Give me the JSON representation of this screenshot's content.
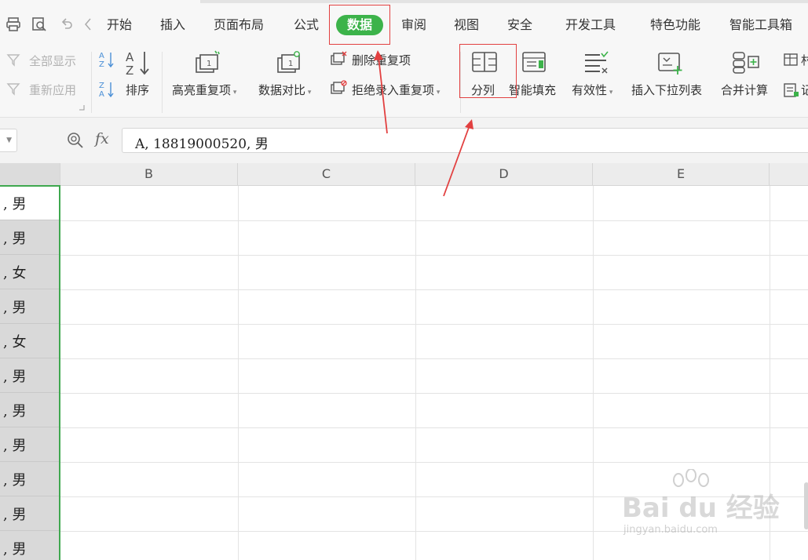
{
  "tabs": [
    "开始",
    "插入",
    "页面布局",
    "公式",
    "数据",
    "审阅",
    "视图",
    "安全",
    "开发工具",
    "特色功能",
    "智能工具箱"
  ],
  "active_tab": "数据",
  "accent_color": "#3cb34a",
  "annotation_color": "#e24040",
  "quick_access": [
    "print-icon",
    "print-preview-icon",
    "undo-icon",
    "nav-back-icon"
  ],
  "ribbon": {
    "show_all": "全部显示",
    "reapply": "重新应用",
    "sort": "排序",
    "highlight_dup": "高亮重复项",
    "compare": "数据对比",
    "remove_dup": "删除重复项",
    "reject_dup": "拒绝录入重复项",
    "text_to_columns": "分列",
    "smart_fill": "智能填充",
    "validity": "有效性",
    "insert_dropdown": "插入下拉列表",
    "consolidate": "合并计算",
    "cut_off_1": "村",
    "cut_off_2": "记"
  },
  "formula_bar": {
    "fx": "fx",
    "value": "A, 18819000520, 男"
  },
  "columns": [
    "B",
    "C",
    "D",
    "E"
  ],
  "column_a_visible": [
    ", 男",
    ", 男",
    ", 女",
    ", 男",
    ", 女",
    ", 男",
    ", 男",
    ", 男",
    ", 男",
    ", 男",
    ", 男"
  ],
  "watermark": {
    "brand": "Bai du 经验",
    "url": "jingyan.baidu.com"
  }
}
